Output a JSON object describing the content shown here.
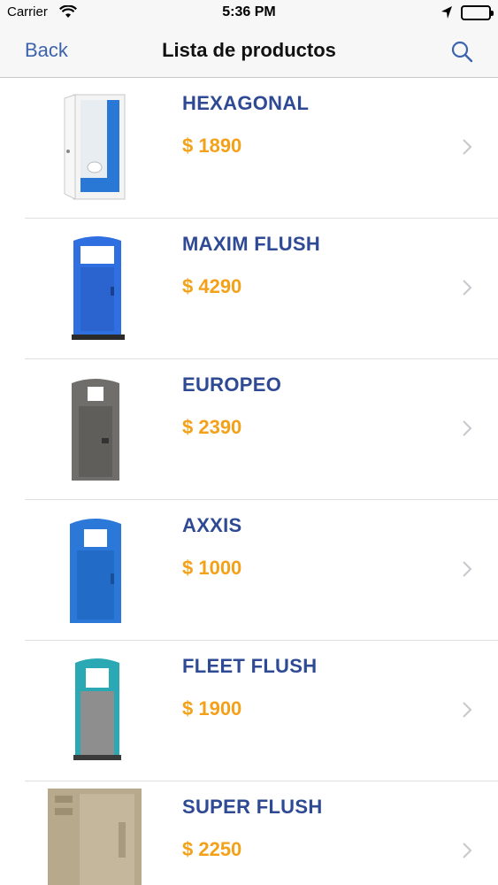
{
  "status": {
    "carrier": "Carrier",
    "time": "5:36 PM"
  },
  "nav": {
    "back_label": "Back",
    "title": "Lista de productos"
  },
  "products": [
    {
      "name": "HEXAGONAL",
      "price": "$ 1890",
      "color": "#f2f2f2",
      "trim": "#2a78d6"
    },
    {
      "name": "MAXIM FLUSH",
      "price": "$ 4290",
      "color": "#2f6fe0",
      "trim": "#2452b8"
    },
    {
      "name": "EUROPEO",
      "price": "$ 2390",
      "color": "#6f6e6b",
      "trim": "#5b5a57"
    },
    {
      "name": "AXXIS",
      "price": "$ 1000",
      "color": "#2b78d8",
      "trim": "#1d5fb3"
    },
    {
      "name": "FLEET FLUSH",
      "price": "$ 1900",
      "color": "#2aa8b3",
      "trim": "#8e8e8e"
    },
    {
      "name": "SUPER FLUSH",
      "price": "$ 2250",
      "color": "#b7a98c",
      "trim": "#9d8f72"
    }
  ],
  "colors": {
    "accent": "#3d63ad",
    "product_name": "#2f4a94",
    "price": "#f4a11a"
  }
}
